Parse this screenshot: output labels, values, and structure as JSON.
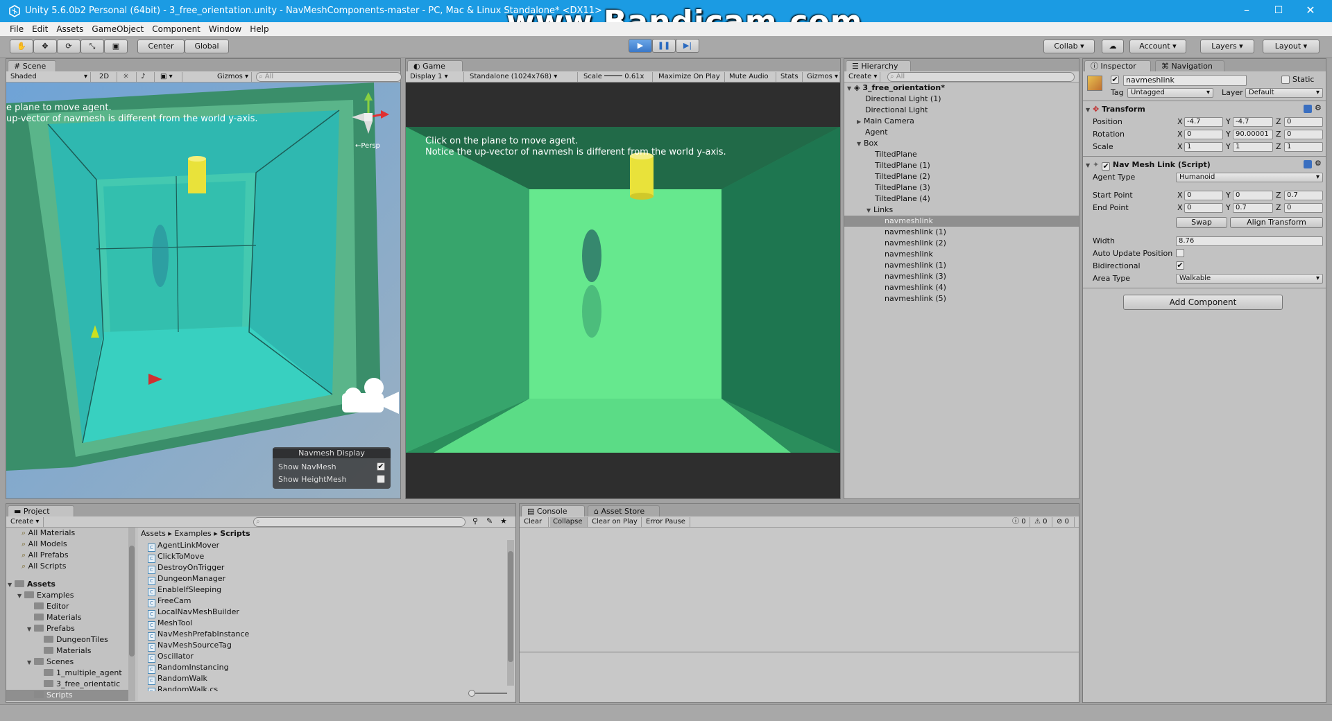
{
  "window": {
    "title": "Unity 5.6.0b2 Personal (64bit) - 3_free_orientation.unity - NavMeshComponents-master - PC, Mac & Linux Standalone* <DX11>",
    "watermark": "www.Bandicam.com",
    "minimize": "–",
    "maximize": "☐",
    "close": "✕"
  },
  "menu": [
    "File",
    "Edit",
    "Assets",
    "GameObject",
    "Component",
    "Window",
    "Help"
  ],
  "toolbar": {
    "center_label": "Center",
    "global_label": "Global",
    "collab_label": "Collab ▾",
    "account_label": "Account",
    "layers_label": "Layers",
    "layout_label": "Layout"
  },
  "scene": {
    "tab": "Scene",
    "shading": "Shaded",
    "mode2d": "2D",
    "gizmos": "Gizmos",
    "search_placeholder": "All",
    "persp": "←Persp",
    "overlay_text1": "e plane to move agent.",
    "overlay_text2": "up-vector of navmesh is different from the world y-axis.",
    "navmesh_display": {
      "title": "Navmesh Display",
      "show_navmesh": "Show NavMesh",
      "show_heightmesh": "Show HeightMesh",
      "navmesh_checked": "✔",
      "heightmesh_checked": ""
    }
  },
  "game": {
    "tab": "Game",
    "display": "Display 1",
    "resolution": "Standalone (1024x768)",
    "scale_label": "Scale",
    "scale_value": "0.61x",
    "maximize": "Maximize On Play",
    "mute": "Mute Audio",
    "stats": "Stats",
    "gizmos": "Gizmos",
    "line1": "Click on the plane to move agent.",
    "line2": "Notice the up-vector of navmesh is different from the world y-axis."
  },
  "hierarchy": {
    "tab": "Hierarchy",
    "create": "Create",
    "search_placeholder": "All",
    "scene_name": "3_free_orientation*",
    "items": [
      {
        "label": "Directional Light (1)"
      },
      {
        "label": "Directional Light"
      },
      {
        "label": "Main Camera"
      },
      {
        "label": "Agent"
      },
      {
        "label": "Box"
      },
      {
        "label": "TiltedPlane"
      },
      {
        "label": "TiltedPlane (1)"
      },
      {
        "label": "TiltedPlane (2)"
      },
      {
        "label": "TiltedPlane (3)"
      },
      {
        "label": "TiltedPlane (4)"
      },
      {
        "label": "Links"
      },
      {
        "label": "navmeshlink"
      },
      {
        "label": "navmeshlink (1)"
      },
      {
        "label": "navmeshlink (2)"
      },
      {
        "label": "navmeshlink"
      },
      {
        "label": "navmeshlink (1)"
      },
      {
        "label": "navmeshlink (3)"
      },
      {
        "label": "navmeshlink (4)"
      },
      {
        "label": "navmeshlink (5)"
      }
    ]
  },
  "inspector": {
    "tab": "Inspector",
    "nav_tab": "Navigation",
    "object_name": "navmeshlink",
    "static_label": "Static",
    "tag_label": "Tag",
    "tag_value": "Untagged",
    "layer_label": "Layer",
    "layer_value": "Default",
    "transform": {
      "title": "Transform",
      "position_label": "Position",
      "rotation_label": "Rotation",
      "scale_label": "Scale",
      "position": {
        "x": "-4.7",
        "y": "-4.7",
        "z": "0"
      },
      "rotation": {
        "x": "0",
        "y": "90.00001",
        "z": "0"
      },
      "scale": {
        "x": "1",
        "y": "1",
        "z": "1"
      }
    },
    "navmeshlink": {
      "title": "Nav Mesh Link (Script)",
      "agent_type_label": "Agent Type",
      "agent_type": "Humanoid",
      "start_point_label": "Start Point",
      "end_point_label": "End Point",
      "start": {
        "x": "0",
        "y": "0",
        "z": "0.7"
      },
      "end": {
        "x": "0",
        "y": "0.7",
        "z": "0"
      },
      "swap": "Swap",
      "align": "Align Transform",
      "width_label": "Width",
      "width": "8.76",
      "auto_update_label": "Auto Update Position",
      "bidirectional_label": "Bidirectional",
      "area_type_label": "Area Type",
      "area_type": "Walkable",
      "bidirectional_checked": "✔"
    },
    "add_component": "Add Component",
    "axis_x": "X",
    "axis_y": "Y",
    "axis_z": "Z"
  },
  "project": {
    "tab": "Project",
    "create": "Create",
    "favorites": [
      "All Materials",
      "All Models",
      "All Prefabs",
      "All Scripts"
    ],
    "tree": [
      {
        "label": "Assets"
      },
      {
        "label": "Examples"
      },
      {
        "label": "Editor"
      },
      {
        "label": "Materials"
      },
      {
        "label": "Prefabs"
      },
      {
        "label": "DungeonTiles"
      },
      {
        "label": "Materials"
      },
      {
        "label": "Scenes"
      },
      {
        "label": "1_multiple_agent"
      },
      {
        "label": "3_free_orientatic"
      },
      {
        "label": "Scripts"
      }
    ],
    "breadcrumb": [
      "Assets",
      "Examples",
      "Scripts"
    ],
    "scripts": [
      "AgentLinkMover",
      "ClickToMove",
      "DestroyOnTrigger",
      "DungeonManager",
      "EnableIfSleeping",
      "FreeCam",
      "LocalNavMeshBuilder",
      "MeshTool",
      "NavMeshPrefabInstance",
      "NavMeshSourceTag",
      "Oscillator",
      "RandomInstancing",
      "RandomWalk",
      "RandomWalk.cs"
    ]
  },
  "console": {
    "tab": "Console",
    "asset_store_tab": "Asset Store",
    "clear": "Clear",
    "collapse": "Collapse",
    "clear_on_play": "Clear on Play",
    "error_pause": "Error Pause",
    "info_count": "0",
    "warn_count": "0",
    "error_count": "0"
  }
}
